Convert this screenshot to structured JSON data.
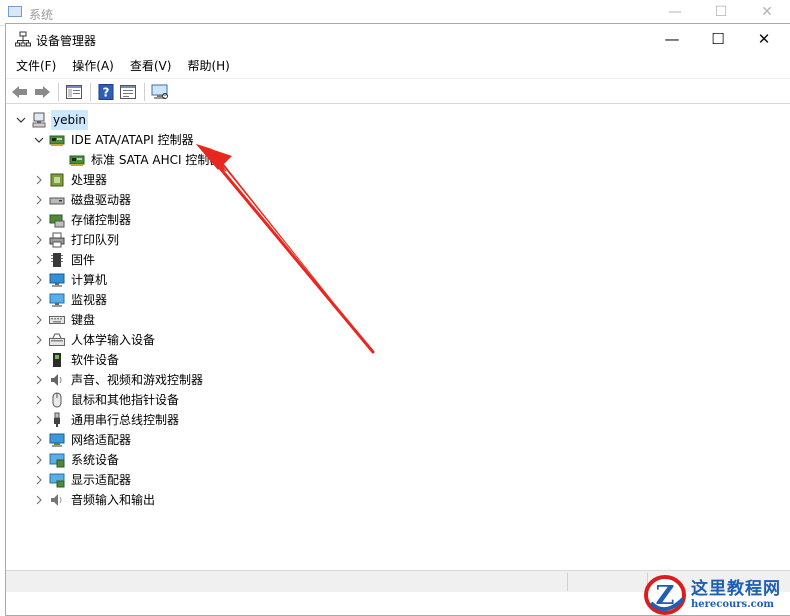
{
  "background_window": {
    "title": "系统",
    "controls": [
      "—",
      "☐",
      "✕"
    ]
  },
  "window": {
    "title": "设备管理器",
    "controls": {
      "minimize": "—",
      "maximize": "☐",
      "close": "✕"
    }
  },
  "menu": [
    {
      "label": "文件(F)",
      "name": "menu-file"
    },
    {
      "label": "操作(A)",
      "name": "menu-action"
    },
    {
      "label": "查看(V)",
      "name": "menu-view"
    },
    {
      "label": "帮助(H)",
      "name": "menu-help"
    }
  ],
  "toolbar": [
    {
      "name": "back-button",
      "icon": "back-arrow-icon"
    },
    {
      "name": "forward-button",
      "icon": "forward-arrow-icon"
    },
    {
      "name": "show-hide-console-tree-button",
      "icon": "console-tree-icon"
    },
    {
      "name": "help-button",
      "icon": "help-icon"
    },
    {
      "name": "properties-button",
      "icon": "properties-icon"
    },
    {
      "name": "scan-hardware-button",
      "icon": "monitor-icon"
    }
  ],
  "tree": {
    "root": {
      "label": "yebin",
      "icon": "computer-icon",
      "expanded": true,
      "selected": true
    },
    "items": [
      {
        "label": "IDE ATA/ATAPI 控制器",
        "icon": "ide-controller-icon",
        "expanded": true,
        "children": [
          {
            "label": "标准 SATA AHCI 控制器",
            "icon": "ide-controller-icon"
          }
        ]
      },
      {
        "label": "处理器",
        "icon": "processor-icon"
      },
      {
        "label": "磁盘驱动器",
        "icon": "disk-drive-icon"
      },
      {
        "label": "存储控制器",
        "icon": "storage-controller-icon"
      },
      {
        "label": "打印队列",
        "icon": "printer-icon"
      },
      {
        "label": "固件",
        "icon": "firmware-icon"
      },
      {
        "label": "计算机",
        "icon": "computer-monitor-icon"
      },
      {
        "label": "监视器",
        "icon": "monitor-icon"
      },
      {
        "label": "键盘",
        "icon": "keyboard-icon"
      },
      {
        "label": "人体学输入设备",
        "icon": "hid-icon"
      },
      {
        "label": "软件设备",
        "icon": "software-device-icon"
      },
      {
        "label": "声音、视频和游戏控制器",
        "icon": "speaker-icon"
      },
      {
        "label": "鼠标和其他指针设备",
        "icon": "mouse-icon"
      },
      {
        "label": "通用串行总线控制器",
        "icon": "usb-icon"
      },
      {
        "label": "网络适配器",
        "icon": "network-adapter-icon"
      },
      {
        "label": "系统设备",
        "icon": "system-device-icon"
      },
      {
        "label": "显示适配器",
        "icon": "display-adapter-icon"
      },
      {
        "label": "音频输入和输出",
        "icon": "audio-io-icon"
      }
    ]
  },
  "colors": {
    "selection": "#cce8ff",
    "arrow": "#e8281e",
    "watermark_blue": "#1e5fb3",
    "watermark_red": "#d81e1e"
  },
  "watermark": {
    "logo_letter": "Z",
    "text_cn": "这里教程网",
    "text_en": "herecours.com"
  }
}
